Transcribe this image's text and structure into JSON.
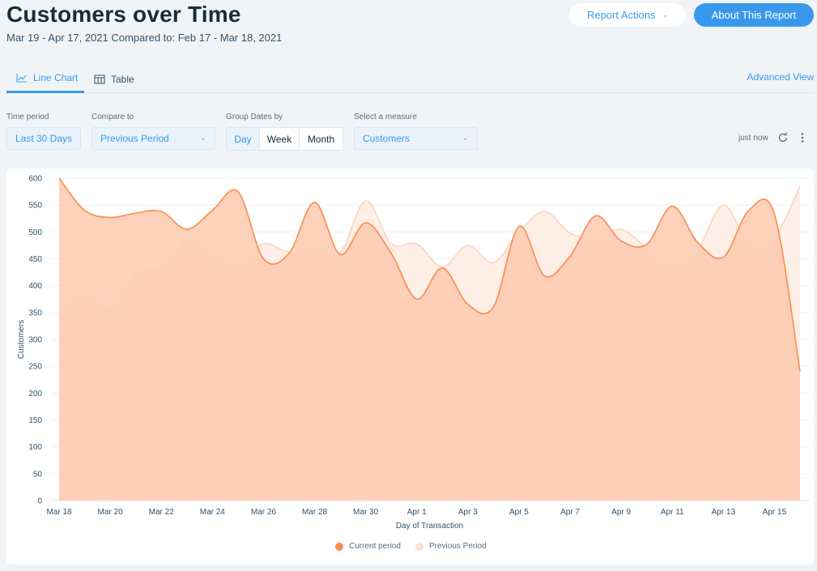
{
  "header": {
    "title": "Customers over Time",
    "subtitle": "Mar 19 - Apr 17, 2021 Compared to: Feb 17 - Mar 18, 2021",
    "report_actions_label": "Report Actions",
    "about_label": "About This Report"
  },
  "tabs": [
    {
      "label": "Line Chart",
      "icon": "line-chart-icon",
      "active": true
    },
    {
      "label": "Table",
      "icon": "table-icon",
      "active": false
    }
  ],
  "advanced_view_label": "Advanced View",
  "filters": {
    "time_period": {
      "label": "Time period",
      "value": "Last 30 Days"
    },
    "compare_to": {
      "label": "Compare to",
      "value": "Previous Period"
    },
    "group_dates": {
      "label": "Group Dates by",
      "options": [
        "Day",
        "Week",
        "Month"
      ],
      "selected": "Day"
    },
    "measure": {
      "label": "Select a measure",
      "value": "Customers"
    }
  },
  "status": {
    "updated": "just now"
  },
  "colors": {
    "accent": "#3899ec",
    "current": "#f98b4f",
    "current_fill": "#fdc9ae",
    "previous_line": "#fcd3bd",
    "previous_fill": "#fdece3"
  },
  "chart_data": {
    "type": "area",
    "title": "",
    "xlabel": "Day of Transaction",
    "ylabel": "Customers",
    "ylim": [
      0,
      600
    ],
    "yticks": [
      0,
      50,
      100,
      150,
      200,
      250,
      300,
      350,
      400,
      450,
      500,
      550,
      600
    ],
    "x": [
      "Mar 18",
      "Mar 19",
      "Mar 20",
      "Mar 21",
      "Mar 22",
      "Mar 23",
      "Mar 24",
      "Mar 25",
      "Mar 26",
      "Mar 27",
      "Mar 28",
      "Mar 29",
      "Mar 30",
      "Mar 31",
      "Apr 1",
      "Apr 2",
      "Apr 3",
      "Apr 4",
      "Apr 5",
      "Apr 6",
      "Apr 7",
      "Apr 8",
      "Apr 9",
      "Apr 10",
      "Apr 11",
      "Apr 12",
      "Apr 13",
      "Apr 14",
      "Apr 15",
      "Apr 16"
    ],
    "xtick_labels": [
      "Mar 18",
      "Mar 20",
      "Mar 22",
      "Mar 24",
      "Mar 26",
      "Mar 28",
      "Mar 30",
      "Apr 1",
      "Apr 3",
      "Apr 5",
      "Apr 7",
      "Apr 9",
      "Apr 11",
      "Apr 13",
      "Apr 15"
    ],
    "grid": true,
    "legend_position": "bottom-center",
    "series": [
      {
        "name": "Current period",
        "values": [
          600,
          540,
          527,
          535,
          538,
          505,
          540,
          575,
          450,
          460,
          555,
          458,
          517,
          460,
          375,
          433,
          365,
          360,
          510,
          418,
          455,
          530,
          483,
          477,
          548,
          480,
          453,
          540,
          533,
          240
        ]
      },
      {
        "name": "Previous Period",
        "values": [
          350,
          385,
          363,
          428,
          438,
          490,
          462,
          440,
          478,
          463,
          475,
          462,
          558,
          478,
          478,
          435,
          475,
          443,
          500,
          538,
          498,
          487,
          505,
          470,
          438,
          468,
          550,
          480,
          490,
          585
        ]
      }
    ]
  }
}
